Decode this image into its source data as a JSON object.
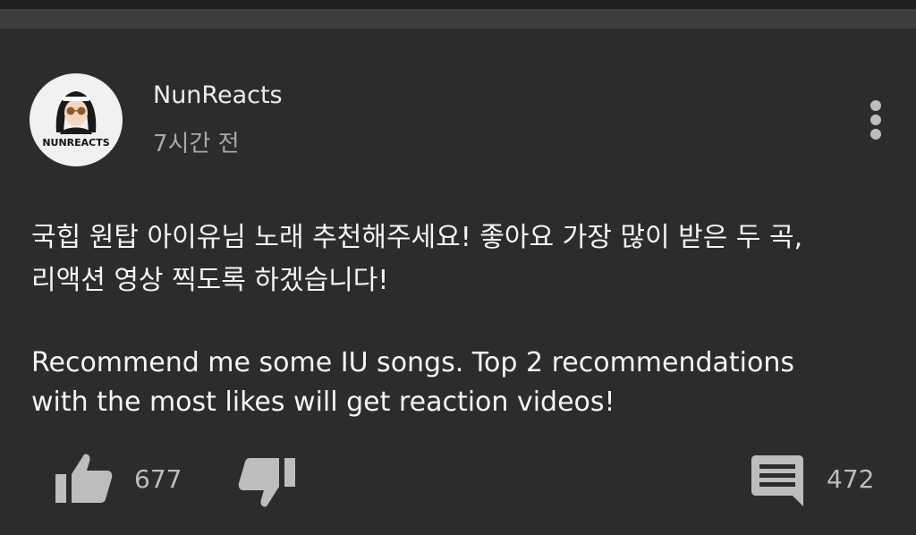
{
  "comment": {
    "author": "NunReacts",
    "time_ago": "7시간 전",
    "avatar_logo_text": "NUNREACTS",
    "text_ko": [
      "국힙 원탑 아이유님 노래 추천해주세요! 좋아요 가장 많이 받은 두 곡,",
      "리액션 영상 찍도록 하겠습니다!"
    ],
    "text_en": [
      "Recommend me some IU songs. Top 2 recommendations",
      "with the most likes will get reaction videos!"
    ],
    "like_count": "677",
    "reply_count": "472",
    "icons": {
      "like": "thumbs-up-icon",
      "dislike": "thumbs-down-icon",
      "reply": "comment-icon",
      "menu": "more-vertical-icon"
    }
  },
  "colors": {
    "background": "#2c2c2c",
    "text": "#f4f4f4",
    "secondary_text": "#a8a8a8",
    "icon": "#bdbdbd"
  }
}
